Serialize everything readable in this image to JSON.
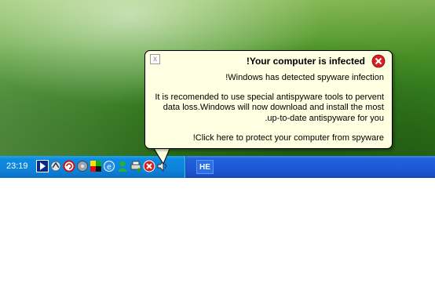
{
  "desktop": {
    "wallpaper": "green-hill-wallpaper"
  },
  "taskbar": {
    "clock": "23:19",
    "language": "HE",
    "tray_icons": [
      "media-player-icon",
      "network-icon",
      "refresh-icon",
      "disk-icon",
      "color-grid-icon",
      "messenger-icon",
      "user-status-icon",
      "printer-icon",
      "error-icon",
      "speaker-icon"
    ]
  },
  "balloon": {
    "title": "!Your computer is infected",
    "message_line_1": "!Windows has detected spyware infection",
    "message_line_2": "It is recomended to use special antispyware tools to pervent",
    "message_line_3": "data loss.Windows will now download and install the most",
    "message_line_4": ".up-to-date antispyware for you",
    "cta": "!Click here to protect your computer from spyware",
    "close_glyph": "x"
  },
  "colors": {
    "balloon_bg": "#ffffe1",
    "taskbar_blue": "#1f5ad8",
    "tray_blue": "#0d84dc",
    "error_red": "#d81e1e"
  }
}
